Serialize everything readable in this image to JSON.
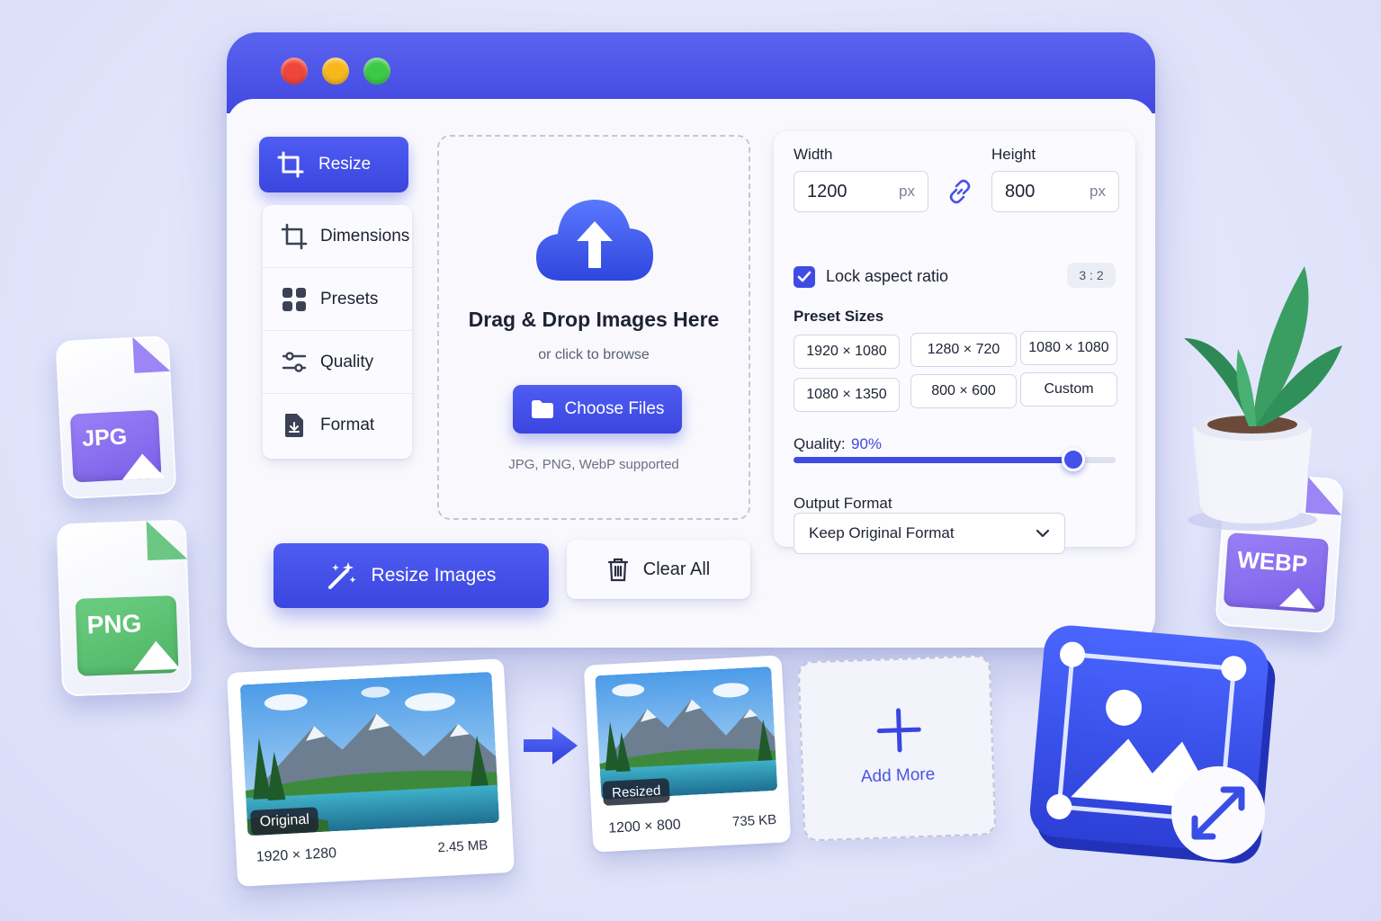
{
  "window": {
    "controls": [
      "close",
      "minimize",
      "maximize"
    ]
  },
  "sidebar": {
    "active": {
      "label": "Resize",
      "icon": "crop-icon"
    },
    "items": [
      {
        "label": "Dimensions",
        "icon": "crop-icon"
      },
      {
        "label": "Presets",
        "icon": "grid-icon"
      },
      {
        "label": "Quality",
        "icon": "sliders-icon"
      },
      {
        "label": "Format",
        "icon": "file-icon"
      }
    ]
  },
  "dropzone": {
    "title": "Drag & Drop Images Here",
    "subtitle": "or click to browse",
    "button_label": "Choose Files",
    "supported": "JPG, PNG, WebP supported"
  },
  "settings": {
    "width_label": "Width",
    "width_value": "1200",
    "width_unit": "px",
    "height_label": "Height",
    "height_value": "800",
    "height_unit": "px",
    "lock_label": "Lock aspect ratio",
    "lock_checked": true,
    "ratio": "3 : 2",
    "presets_title": "Preset Sizes",
    "presets": [
      "1920 × 1080",
      "1280 × 720",
      "1080 × 1080",
      "1080 × 1350",
      "800 × 600",
      "Custom"
    ],
    "quality_label": "Quality:",
    "quality_value": "90%",
    "quality_fraction": 0.87,
    "output_label": "Output Format",
    "output_value": "Keep Original Format"
  },
  "actions": {
    "primary": "Resize Images",
    "secondary": "Clear All"
  },
  "badges": [
    "JPG",
    "PNG",
    "WEBP"
  ],
  "preview": {
    "original": {
      "label": "Original",
      "dims": "1920 × 1280",
      "size": "2.45 MB"
    },
    "resized": {
      "label": "Resized",
      "dims": "1200 × 800",
      "size": "735 KB"
    },
    "add_more": "Add More"
  },
  "colors": {
    "accent": "#4148e0",
    "jpg": "#8a6cf0",
    "png": "#5cc172",
    "webp": "#8a6cf0",
    "close": "#f0453a",
    "minimize": "#f7b81c",
    "maximize": "#3cc948"
  }
}
